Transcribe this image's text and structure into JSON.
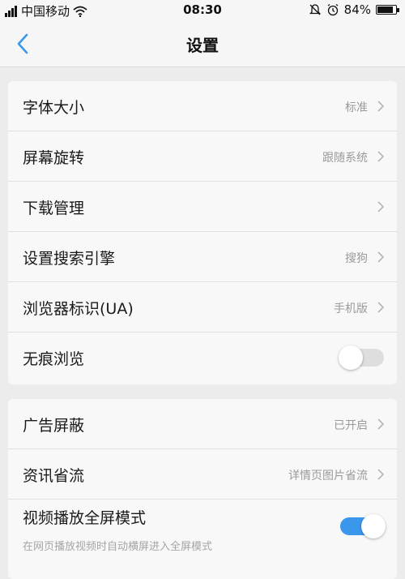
{
  "status_bar": {
    "carrier": "中国移动",
    "time": "08:30",
    "battery": "84%"
  },
  "header": {
    "title": "设置"
  },
  "group1": [
    {
      "label": "字体大小",
      "value": "标准"
    },
    {
      "label": "屏幕旋转",
      "value": "跟随系统"
    },
    {
      "label": "下载管理",
      "value": ""
    },
    {
      "label": "设置搜索引擎",
      "value": "搜狗"
    },
    {
      "label": "浏览器标识(UA)",
      "value": "手机版"
    },
    {
      "label": "无痕浏览",
      "toggle": false
    }
  ],
  "group2": [
    {
      "label": "广告屏蔽",
      "value": "已开启"
    },
    {
      "label": "资讯省流",
      "value": "详情页图片省流"
    },
    {
      "label": "视频播放全屏模式",
      "sub": "在网页播放视频时自动横屏进入全屏模式",
      "toggle": true
    }
  ],
  "colors": {
    "accent": "#3a97ec",
    "background": "#ececec",
    "card": "#f8f8f8",
    "secondary_text": "#9a9a9a"
  }
}
